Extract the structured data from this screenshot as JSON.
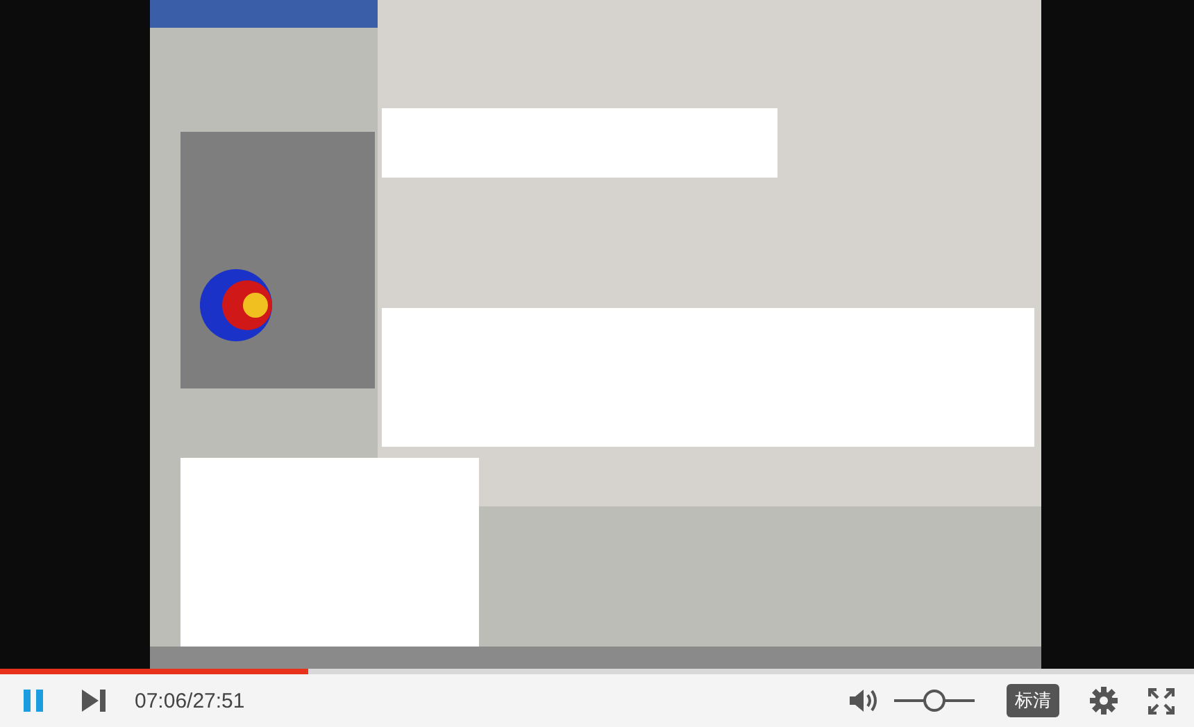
{
  "progress": {
    "level": 0.258
  },
  "controls": {
    "playing": true,
    "time": "07:06/27:51",
    "volume": {
      "level": 0.5
    },
    "quality": "标清"
  }
}
